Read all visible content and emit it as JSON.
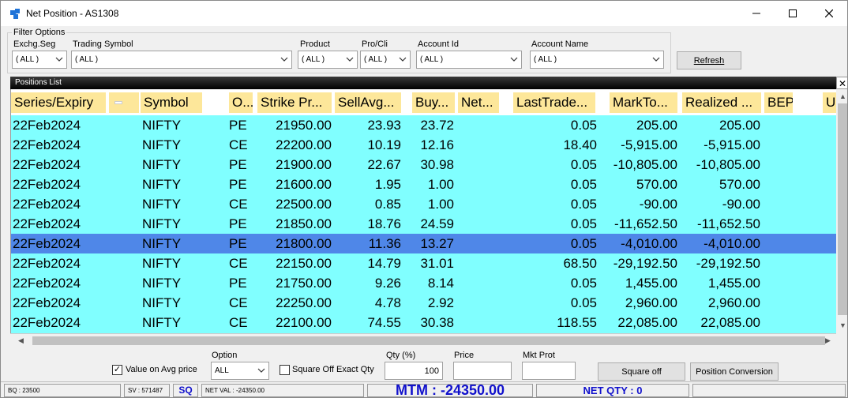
{
  "window": {
    "title": "Net Position - AS1308"
  },
  "filter": {
    "legend": "Filter Options",
    "labels": [
      "Exchg.Seg",
      "Trading Symbol",
      "Product",
      "Pro/Cli",
      "Account Id",
      "Account Name"
    ],
    "values": [
      "( ALL )",
      "( ALL )",
      "( ALL )",
      "( ALL )",
      "( ALL )",
      "( ALL )"
    ],
    "refresh_label": "Refresh"
  },
  "grid": {
    "title": "Positions List",
    "columns": [
      "Series/Expiry",
      "Symbol",
      "O...",
      "Strike Pr...",
      "SellAvg...",
      "Buy...",
      "Net...",
      "LastTrade...",
      "MarkTo...",
      "Realized ...",
      "BEP",
      "U"
    ],
    "rows": [
      {
        "expiry": "22Feb2024",
        "symbol": "NIFTY",
        "opt": "PE",
        "strike": "21950.00",
        "sell": "23.93",
        "buy": "23.72",
        "ltp": "0.05",
        "mtm": "205.00",
        "realized": "205.00"
      },
      {
        "expiry": "22Feb2024",
        "symbol": "NIFTY",
        "opt": "CE",
        "strike": "22200.00",
        "sell": "10.19",
        "buy": "12.16",
        "ltp": "18.40",
        "mtm": "-5,915.00",
        "realized": "-5,915.00"
      },
      {
        "expiry": "22Feb2024",
        "symbol": "NIFTY",
        "opt": "PE",
        "strike": "21900.00",
        "sell": "22.67",
        "buy": "30.98",
        "ltp": "0.05",
        "mtm": "-10,805.00",
        "realized": "-10,805.00"
      },
      {
        "expiry": "22Feb2024",
        "symbol": "NIFTY",
        "opt": "PE",
        "strike": "21600.00",
        "sell": "1.95",
        "buy": "1.00",
        "ltp": "0.05",
        "mtm": "570.00",
        "realized": "570.00"
      },
      {
        "expiry": "22Feb2024",
        "symbol": "NIFTY",
        "opt": "CE",
        "strike": "22500.00",
        "sell": "0.85",
        "buy": "1.00",
        "ltp": "0.05",
        "mtm": "-90.00",
        "realized": "-90.00"
      },
      {
        "expiry": "22Feb2024",
        "symbol": "NIFTY",
        "opt": "PE",
        "strike": "21850.00",
        "sell": "18.76",
        "buy": "24.59",
        "ltp": "0.05",
        "mtm": "-11,652.50",
        "realized": "-11,652.50"
      },
      {
        "expiry": "22Feb2024",
        "symbol": "NIFTY",
        "opt": "PE",
        "strike": "21800.00",
        "sell": "11.36",
        "buy": "13.27",
        "ltp": "0.05",
        "mtm": "-4,010.00",
        "realized": "-4,010.00"
      },
      {
        "expiry": "22Feb2024",
        "symbol": "NIFTY",
        "opt": "CE",
        "strike": "22150.00",
        "sell": "14.79",
        "buy": "31.01",
        "ltp": "68.50",
        "mtm": "-29,192.50",
        "realized": "-29,192.50"
      },
      {
        "expiry": "22Feb2024",
        "symbol": "NIFTY",
        "opt": "PE",
        "strike": "21750.00",
        "sell": "9.26",
        "buy": "8.14",
        "ltp": "0.05",
        "mtm": "1,455.00",
        "realized": "1,455.00"
      },
      {
        "expiry": "22Feb2024",
        "symbol": "NIFTY",
        "opt": "CE",
        "strike": "22250.00",
        "sell": "4.78",
        "buy": "2.92",
        "ltp": "0.05",
        "mtm": "2,960.00",
        "realized": "2,960.00"
      },
      {
        "expiry": "22Feb2024",
        "symbol": "NIFTY",
        "opt": "CE",
        "strike": "22100.00",
        "sell": "74.55",
        "buy": "30.38",
        "ltp": "118.55",
        "mtm": "22,085.00",
        "realized": "22,085.00"
      }
    ],
    "selected_row": 6
  },
  "bottom": {
    "value_on_avg_label": "Value on Avg  price",
    "value_on_avg_checked": true,
    "option_label": "Option",
    "option_value": "ALL",
    "square_exact_label": "Square Off Exact Qty",
    "square_exact_checked": false,
    "qty_label": "Qty (%)",
    "qty_value": "100",
    "price_label": "Price",
    "mkt_prot_label": "Mkt Prot",
    "square_off_label": "Square off",
    "position_conversion_label": "Position Conversion"
  },
  "status": {
    "bq": "BQ : 23500",
    "sv": "SV : 571487",
    "sq": "SQ",
    "net_val": "NET VAL : -24350.00",
    "mtm": "MTM : -24350.00",
    "net_qty": "NET QTY : 0"
  },
  "colors": {
    "grid_bg": "#80ffff",
    "header_bg": "#fde79a",
    "selected_row": "#4f87e8",
    "status_accent": "#1111cc"
  }
}
